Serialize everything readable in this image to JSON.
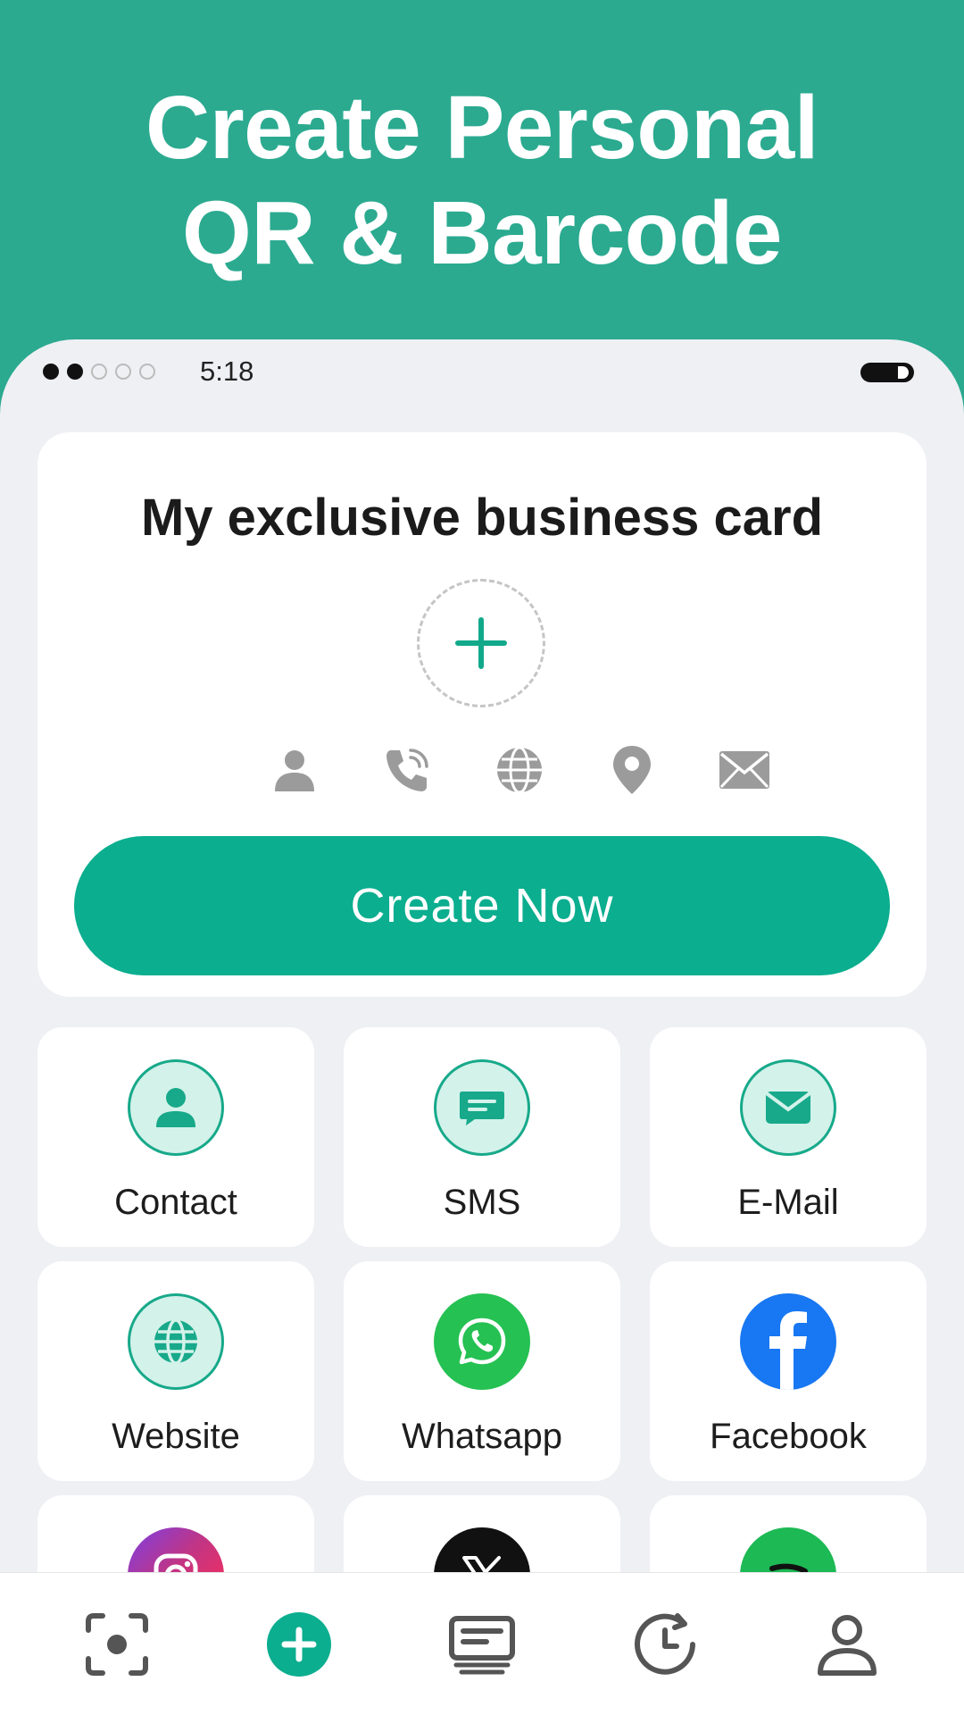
{
  "hero": {
    "line1": "Create Personal",
    "line2": "QR & Barcode"
  },
  "status_bar": {
    "time": "5:18",
    "signal_filled": 2,
    "signal_total": 5
  },
  "business_card": {
    "title": "My exclusive business card",
    "add_icon": "plus-icon",
    "field_icons": [
      "person-icon",
      "phone-icon",
      "globe-icon",
      "location-pin-icon",
      "envelope-icon"
    ],
    "button_label": "Create Now"
  },
  "tiles": [
    {
      "label": "Contact",
      "icon": "contact-icon"
    },
    {
      "label": "SMS",
      "icon": "sms-icon"
    },
    {
      "label": "E-Mail",
      "icon": "email-icon"
    },
    {
      "label": "Website",
      "icon": "website-icon"
    },
    {
      "label": "Whatsapp",
      "icon": "whatsapp-icon"
    },
    {
      "label": "Facebook",
      "icon": "facebook-icon"
    },
    {
      "label": "",
      "icon": "instagram-icon"
    },
    {
      "label": "",
      "icon": "x-icon"
    },
    {
      "label": "",
      "icon": "spotify-icon"
    }
  ],
  "bottom_nav": [
    "scan-icon",
    "create-icon",
    "templates-icon",
    "history-icon",
    "profile-icon"
  ],
  "colors": {
    "accent": "#0BAE8F",
    "hero_bg": "#2BAA90",
    "whatsapp": "#25C152",
    "facebook": "#1877F2",
    "x": "#111111",
    "spotify": "#1DB954"
  }
}
